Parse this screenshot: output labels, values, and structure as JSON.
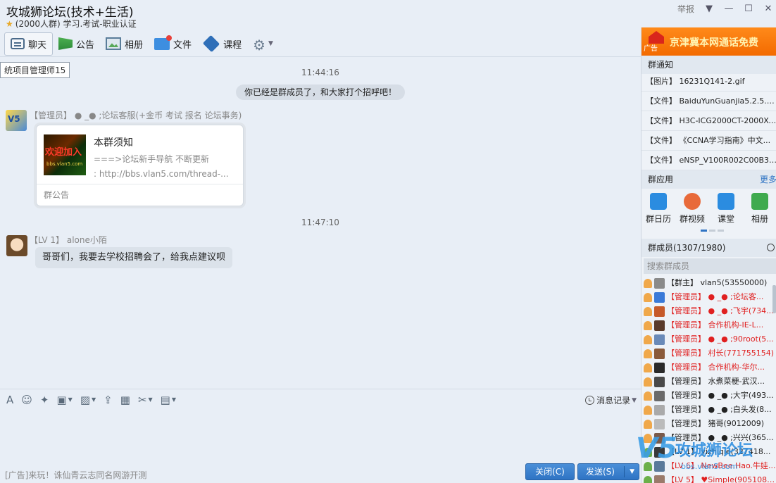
{
  "window": {
    "title": "攻城狮论坛(技术+生活)",
    "subtitle": "(2000人群) 学习.考试-职业认证",
    "report": "举报"
  },
  "toolbar": {
    "chat": "聊天",
    "notice": "公告",
    "album": "相册",
    "file": "文件",
    "course": "课程"
  },
  "chat": {
    "tooltip": "统项目管理师15",
    "time1": "11:44:16",
    "system_message": "你已经是群成员了，和大家打个招呼吧！",
    "msg1_sender": "【管理员】 ● _● ;论坛客服(+金币 考试 报名 论坛事务)",
    "card_title": "本群须知",
    "card_line1": "===>论坛新手导航 不断更新",
    "card_line2": ": http://bbs.vlan5.com/thread-...",
    "card_footer": "群公告",
    "time2": "11:47:10",
    "msg2_sender": "【LV 1】 alone小陌",
    "msg2_text": "哥哥们，我要去学校招聘会了，给我点建议呗"
  },
  "input": {
    "history": "消息记录",
    "ad": "[广告]来玩！诛仙青云志同名网游开测",
    "close": "关闭(C)",
    "send": "发送(S)"
  },
  "right": {
    "banner_tag": "广告",
    "banner_text": "京津冀本网通话免费",
    "notice_header": "群通知",
    "notices": [
      "【图片】 16231Q141-2.gif",
      "【文件】 BaiduYunGuanjia5.2.5.7_Sp...",
      "【文件】 H3C-ICG2000CT-2000X-CM...",
      "【文件】 《CCNA学习指南》中文...",
      "【文件】 eNSP_V100R002C00B390_S..."
    ],
    "apps_header": "群应用",
    "apps_more": "更多",
    "apps": [
      "群日历",
      "群视频",
      "课堂",
      "相册"
    ],
    "members_header": "群成员(1307/1980)",
    "search_placeholder": "搜索群成员",
    "members": [
      {
        "text": "【群主】 vlan5(53550000)",
        "color": "#222222"
      },
      {
        "text": "【管理员】 ● _● ;论坛客...",
        "color": "#e02020"
      },
      {
        "text": "【管理员】 ● _● ;飞宇(734...",
        "color": "#e02020"
      },
      {
        "text": "【管理员】 合作机构-IE-L...",
        "color": "#e02020"
      },
      {
        "text": "【管理员】 ● _● ;90root(5...",
        "color": "#e02020"
      },
      {
        "text": "【管理员】 村长(771755154)",
        "color": "#e02020"
      },
      {
        "text": "【管理员】 合作机构-华尔...",
        "color": "#e02020"
      },
      {
        "text": "【管理员】 水煮菜梗-武汉...",
        "color": "#222222"
      },
      {
        "text": "【管理员】 ● _● ;大宇(493...",
        "color": "#222222"
      },
      {
        "text": "【管理员】 ● _● ;白头发(8...",
        "color": "#222222"
      },
      {
        "text": "【管理员】 猪哥(9012009)",
        "color": "#222222"
      },
      {
        "text": "【管理员】 ● _● ;兴兴(365...",
        "color": "#222222"
      },
      {
        "text": "【LV 1】 yizhiqie(327418...",
        "color": "#222222"
      },
      {
        "text": "【LV 6】 NewBee.Hao.牛娃...",
        "color": "#e02020"
      },
      {
        "text": "【LV 5】 ♥Simple(905108379)",
        "color": "#e02020"
      }
    ]
  },
  "watermark": {
    "logo": "V5",
    "name": "攻城狮论坛",
    "url": "bbs.vlan5.com"
  }
}
